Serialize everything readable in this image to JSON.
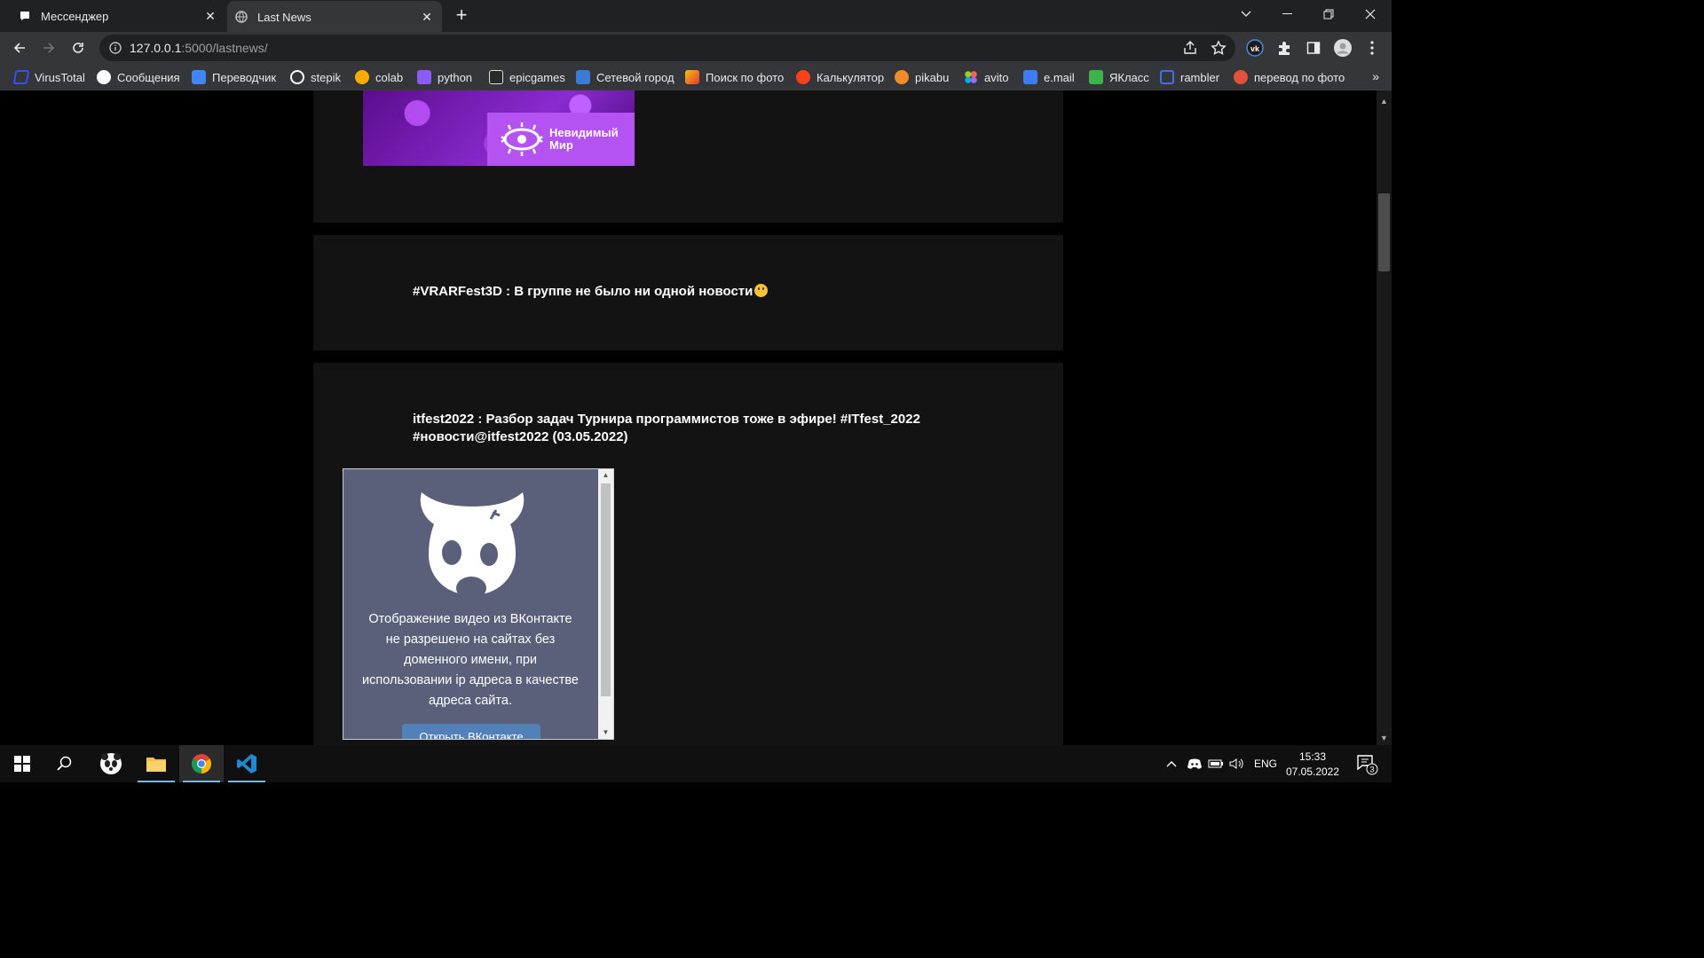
{
  "tabs": [
    {
      "title": "Мессенджер",
      "icon": "messenger-icon"
    },
    {
      "title": "Last News",
      "icon": "globe-icon",
      "active": true
    }
  ],
  "address": {
    "host": "127.0.0.1",
    "path": ":5000/lastnews/"
  },
  "bookmarks": [
    {
      "label": "VirusTotal",
      "icon": "virustotal-icon",
      "color": "#394eff"
    },
    {
      "label": "Сообщения",
      "icon": "messages-icon",
      "color": "#ffffff"
    },
    {
      "label": "Переводчик",
      "icon": "translate-icon",
      "color": "#4285f4"
    },
    {
      "label": "stepik",
      "icon": "stepik-icon",
      "color": "#ffffff"
    },
    {
      "label": "colab",
      "icon": "colab-icon",
      "color": "#f9ab00"
    },
    {
      "label": "python",
      "icon": "python-icon",
      "color": "#8a5cf5"
    },
    {
      "label": "epicgames",
      "icon": "epicgames-icon",
      "color": "#dddddd"
    },
    {
      "label": "Сетевой город",
      "icon": "netcity-icon",
      "color": "#3a7bd5"
    },
    {
      "label": "Поиск по фото",
      "icon": "photo-search-icon",
      "color": "#f4c20d"
    },
    {
      "label": "Калькулятор",
      "icon": "yandex-icon",
      "color": "#fc3f1d"
    },
    {
      "label": "pikabu",
      "icon": "pikabu-icon",
      "color": "#f28c28"
    },
    {
      "label": "avito",
      "icon": "avito-icon",
      "color": "#97cf26"
    },
    {
      "label": "e.mail",
      "icon": "mail-icon",
      "color": "#3d7cf4"
    },
    {
      "label": "ЯКласс",
      "icon": "yaklass-icon",
      "color": "#3bb54a"
    },
    {
      "label": "rambler",
      "icon": "rambler-icon",
      "color": "#3f6ef5"
    },
    {
      "label": "перевод по фото",
      "icon": "photo-translate-icon",
      "color": "#e0533a"
    }
  ],
  "banner": {
    "text_line1": "Невидимый",
    "text_line2": "Мир"
  },
  "posts": [
    {
      "title": "#VRARFest3D : В группе не было ни одной новости"
    },
    {
      "title": "itfest2022 : Разбор задач Турнира программистов тоже в эфире! #ITfest_2022 #новости@itfest2022 (03.05.2022)"
    }
  ],
  "vk_embed": {
    "message": "Отображение видео из ВКонтакте не разрешено на сайтах без доменного имени, при использовании ip адреса в качестве адреса сайта.",
    "button": "Открыть ВКонтакте"
  },
  "taskbar": {
    "language": "ENG",
    "time": "15:33",
    "date": "07.05.2022",
    "notifications": "3"
  }
}
